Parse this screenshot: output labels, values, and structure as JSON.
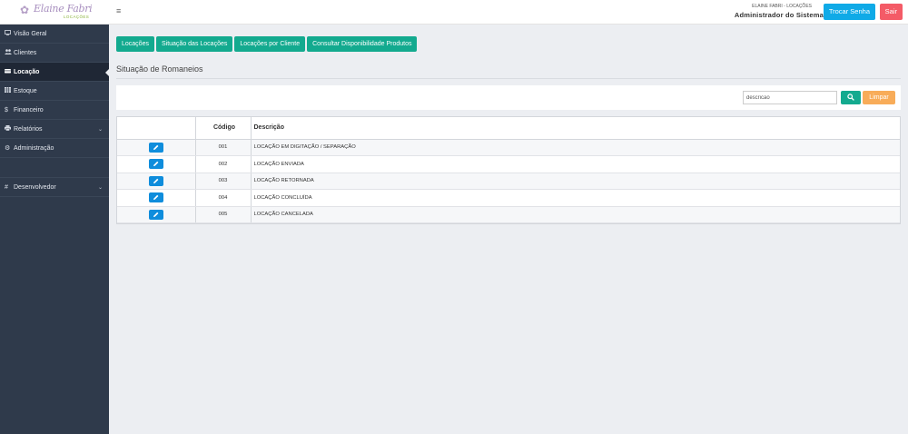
{
  "brand": {
    "logo_text": "Elaine Fabri",
    "logo_sub": "LOCAÇÕES"
  },
  "header": {
    "menu_icon": "hamburger-icon",
    "company": "ELAINE FABRI - LOCAÇÕES",
    "role": "Administrador do Sistema",
    "change_password_label": "Trocar Senha",
    "logout_label": "Sair"
  },
  "sidebar": {
    "items": [
      {
        "label": "Visão Geral",
        "icon": "monitor-icon"
      },
      {
        "label": "Clientes",
        "icon": "users-icon"
      },
      {
        "label": "Locação",
        "icon": "box-icon"
      },
      {
        "label": "Estoque",
        "icon": "grid-icon"
      },
      {
        "label": "Financeiro",
        "icon": "dollar-icon"
      },
      {
        "label": "Relatórios",
        "icon": "print-icon"
      },
      {
        "label": "Administração",
        "icon": "gear-icon"
      },
      {
        "label": "Desenvolvedor",
        "icon": "hash-icon"
      }
    ]
  },
  "tabs": [
    {
      "label": "Locações"
    },
    {
      "label": "Situação das Locações"
    },
    {
      "label": "Locações por Cliente"
    },
    {
      "label": "Consultar Disponibilidade Produtos"
    }
  ],
  "page": {
    "title": "Situação de Romaneios"
  },
  "filter": {
    "search_value": "",
    "search_placeholder": "descricao",
    "clear_label": "Limpar"
  },
  "table": {
    "columns": [
      "",
      "Código",
      "Descrição"
    ],
    "rows": [
      {
        "code": "001",
        "description": "LOCAÇÃO EM DIGITAÇÃO / SEPARAÇÃO"
      },
      {
        "code": "002",
        "description": "LOCAÇÃO ENVIADA"
      },
      {
        "code": "003",
        "description": "LOCAÇÃO RETORNADA"
      },
      {
        "code": "004",
        "description": "LOCAÇÃO CONCLUÍDA"
      },
      {
        "code": "005",
        "description": "LOCAÇÃO CANCELADA"
      }
    ]
  },
  "colors": {
    "sidebar_bg": "#2f3a4b",
    "accent_green": "#13aa8f",
    "primary_blue": "#0faae7",
    "danger_red": "#f45b67",
    "warning_orange": "#f8ac59",
    "edit_blue": "#0f8ddc"
  }
}
